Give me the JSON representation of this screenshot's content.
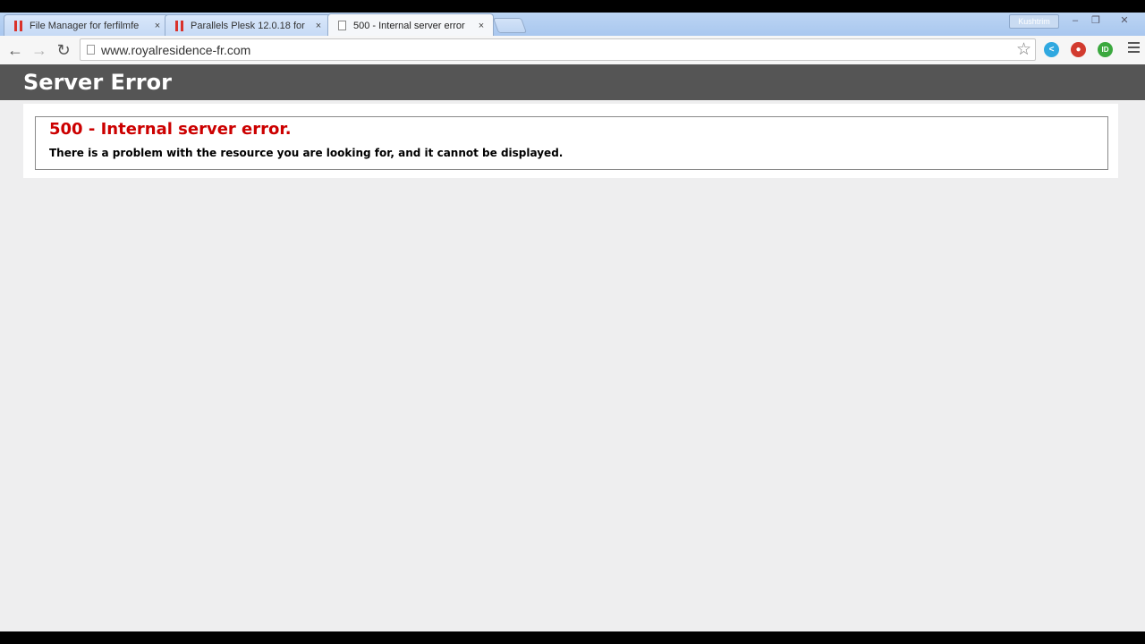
{
  "browser": {
    "tabs": [
      {
        "title": "File Manager for ferfilmfe",
        "close": "×"
      },
      {
        "title": "Parallels Plesk 12.0.18 for",
        "close": "×"
      },
      {
        "title": "500 - Internal server error",
        "close": "×"
      }
    ],
    "profile_name": "Kushtrim",
    "window_buttons": {
      "minimize": "–",
      "restore": "❐",
      "close": "✕"
    },
    "nav": {
      "back": "←",
      "forward": "→",
      "reload": "↻"
    },
    "url": "www.royalresidence-fr.com",
    "bookmark_icon": "☆",
    "extensions": [
      {
        "name": "share-extension-icon",
        "glyph": "<",
        "color": "#2fa8e0"
      },
      {
        "name": "adblock-extension-icon",
        "glyph": "●",
        "color": "#d23b2f"
      },
      {
        "name": "green-extension-icon",
        "glyph": "ID",
        "color": "#3aa83e"
      }
    ]
  },
  "page": {
    "header_title": "Server Error",
    "error_title": "500 - Internal server error.",
    "error_message": "There is a problem with the resource you are looking for, and it cannot be displayed.",
    "colors": {
      "header_bg": "#555555",
      "error_title": "#cc0000"
    }
  }
}
